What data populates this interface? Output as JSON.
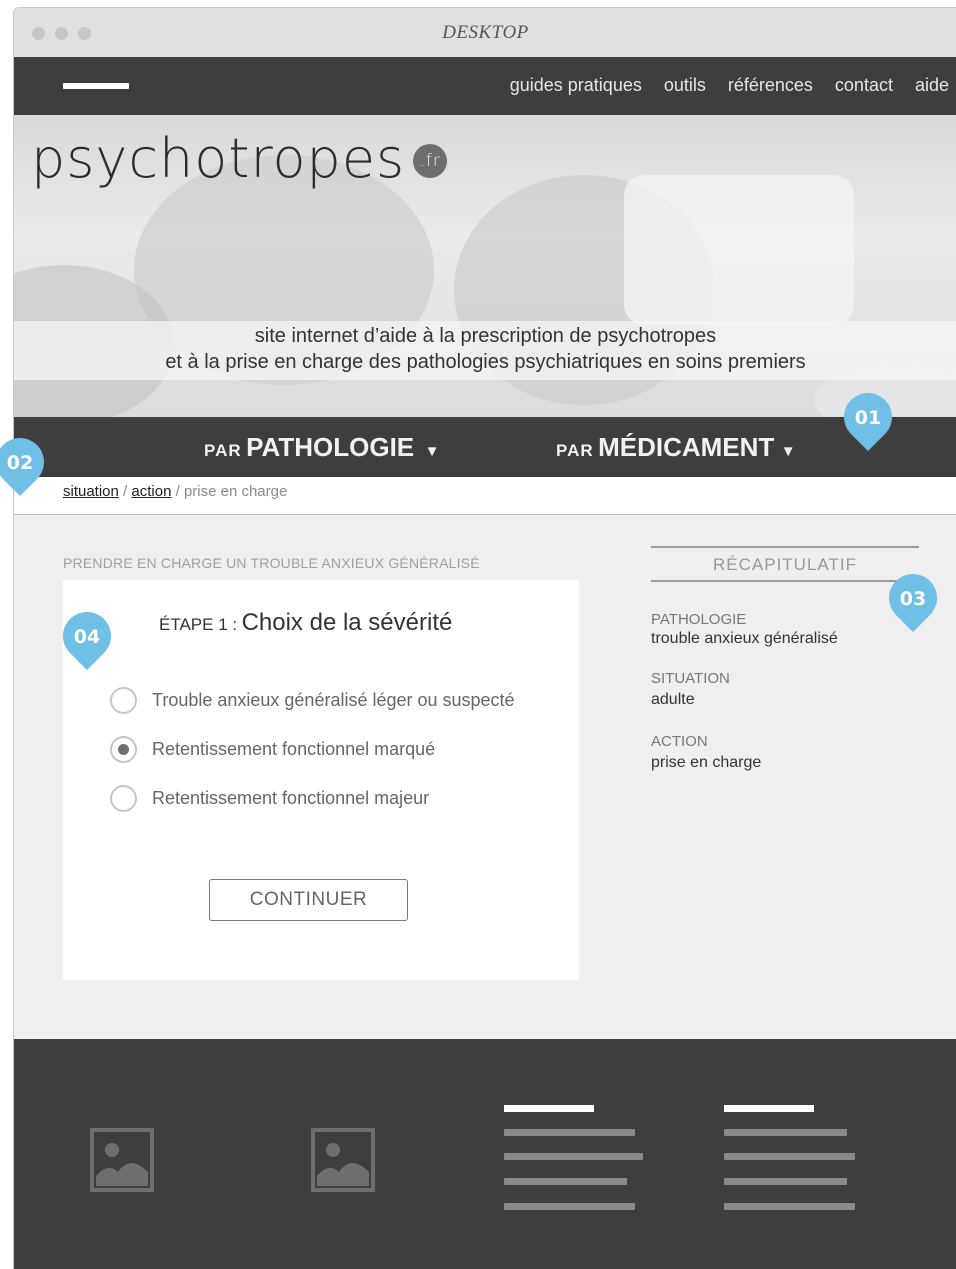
{
  "window": {
    "title": "DESKTOP"
  },
  "nav": {
    "links": [
      "guides pratiques",
      "outils",
      "références",
      "contact",
      "aide"
    ]
  },
  "hero": {
    "logo": "psychotropes",
    "logo_badge": ".fr",
    "tagline_line1": "site internet d’aide à la prescription de psychotropes",
    "tagline_line2": "et à la prise en charge des pathologies psychiatriques en soins premiers"
  },
  "categories": {
    "pathologie": {
      "prefix": "PAR",
      "label": "PATHOLOGIE",
      "arrow": "▼"
    },
    "medicament": {
      "prefix": "PAR",
      "label": "MÉDICAMENT",
      "arrow": "▼"
    }
  },
  "breadcrumb": {
    "item1": "situation",
    "sep": "/",
    "item2": "action",
    "current": "prise en charge"
  },
  "main": {
    "section_title": "PRENDRE EN CHARGE UN TROUBLE ANXIEUX GÉNÉRALISÉ",
    "step_label": "ÉTAPE 1 :",
    "step_text": "Choix de la sévérité",
    "options": [
      {
        "label": "Trouble anxieux généralisé léger ou suspecté",
        "selected": false
      },
      {
        "label": "Retentissement fonctionnel marqué",
        "selected": true
      },
      {
        "label": "Retentissement fonctionnel majeur",
        "selected": false
      }
    ],
    "continue_label": "CONTINUER"
  },
  "recap": {
    "title": "RÉCAPITULATIF",
    "items": [
      {
        "key": "PATHOLOGIE",
        "value": "trouble anxieux généralisé"
      },
      {
        "key": "SITUATION",
        "value": "adulte"
      },
      {
        "key": "ACTION",
        "value": "prise en charge"
      }
    ]
  },
  "markers": [
    "01",
    "02",
    "03",
    "04"
  ],
  "colors": {
    "nav_bg": "#3e3e3e",
    "marker": "#70bfe6",
    "content_bg": "#efefef"
  },
  "icons": [
    "menu-icon",
    "image-placeholder-icon"
  ]
}
